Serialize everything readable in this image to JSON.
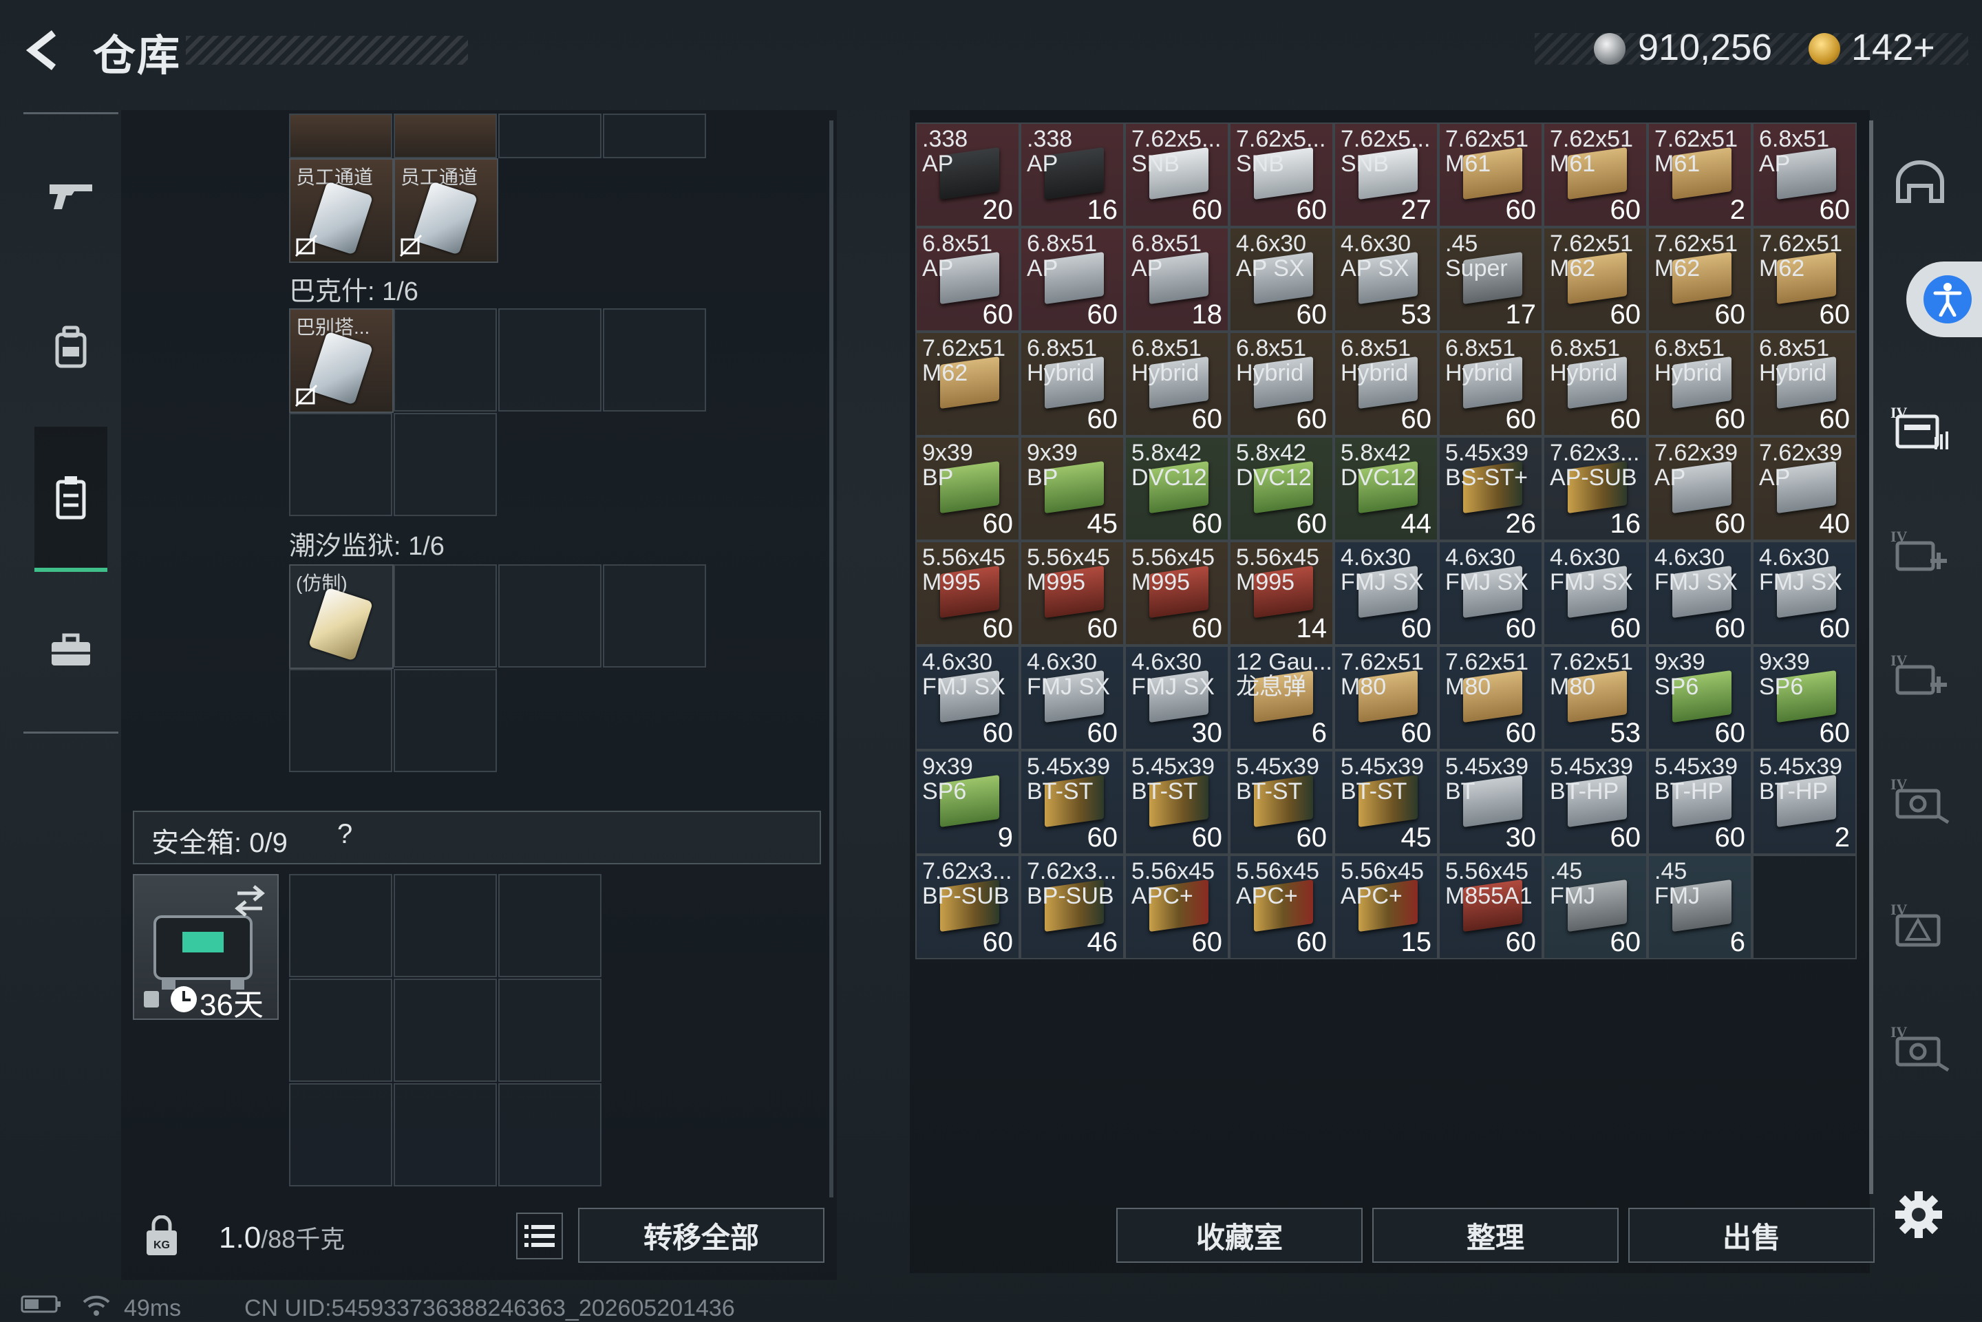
{
  "header": {
    "title": "仓库",
    "currency1": "910,256",
    "currency2": "142+"
  },
  "left_rail": {
    "icons": [
      "gun-icon",
      "backpack-icon",
      "storage-icon",
      "briefcase-icon"
    ]
  },
  "stash": {
    "item_label_1": "员工通道",
    "item_label_2": "员工通道",
    "section1_label": "巴克什: 1/6",
    "item_label_3": "巴别塔...",
    "section2_label": "潮汐监狱: 1/6",
    "item_label_4": "(仿制)",
    "safebox_label": "安全箱:  0/9",
    "safebox_help": "?",
    "safebox_days": "36天",
    "weight_value": "1.0",
    "weight_max": "/88千克",
    "transfer_label": "转移全部"
  },
  "ammo": [
    {
      "n1": ".338",
      "n2": "AP",
      "count": "20",
      "kind": "dark-box",
      "bg": "#4a2b30"
    },
    {
      "n1": ".338",
      "n2": "AP",
      "count": "16",
      "kind": "dark-box",
      "bg": "#4a2b30"
    },
    {
      "n1": "7.62x5...",
      "n2": "SNB",
      "count": "60",
      "kind": "white-box",
      "bg": "#4a2b30"
    },
    {
      "n1": "7.62x5...",
      "n2": "SNB",
      "count": "60",
      "kind": "white-box",
      "bg": "#4a2b30"
    },
    {
      "n1": "7.62x5...",
      "n2": "SNB",
      "count": "27",
      "kind": "white-box",
      "bg": "#4a2b30"
    },
    {
      "n1": "7.62x51",
      "n2": "M61",
      "count": "60",
      "kind": "tan-box",
      "bg": "#4a2b30"
    },
    {
      "n1": "7.62x51",
      "n2": "M61",
      "count": "60",
      "kind": "tan-box",
      "bg": "#4a2b30"
    },
    {
      "n1": "7.62x51",
      "n2": "M61",
      "count": "2",
      "kind": "tan-box",
      "bg": "#4a2b30"
    },
    {
      "n1": "6.8x51",
      "n2": "AP",
      "count": "60",
      "kind": "silver-box",
      "bg": "#4a2b30"
    },
    {
      "n1": "6.8x51",
      "n2": "AP",
      "count": "60",
      "kind": "silver-box",
      "bg": "#4a2b30"
    },
    {
      "n1": "6.8x51",
      "n2": "AP",
      "count": "60",
      "kind": "silver-box",
      "bg": "#4a2b30"
    },
    {
      "n1": "6.8x51",
      "n2": "AP",
      "count": "18",
      "kind": "silver-box",
      "bg": "#4a2b30"
    },
    {
      "n1": "4.6x30",
      "n2": "AP SX",
      "count": "60",
      "kind": "silver-box",
      "bg": "#3e3428"
    },
    {
      "n1": "4.6x30",
      "n2": "AP SX",
      "count": "53",
      "kind": "silver-box",
      "bg": "#3e3428"
    },
    {
      "n1": ".45",
      "n2": "Super",
      "count": "17",
      "kind": "grey-box",
      "bg": "#3e3428"
    },
    {
      "n1": "7.62x51",
      "n2": "M62",
      "count": "60",
      "kind": "tan-box",
      "bg": "#3e3428"
    },
    {
      "n1": "7.62x51",
      "n2": "M62",
      "count": "60",
      "kind": "tan-box",
      "bg": "#3e3428"
    },
    {
      "n1": "7.62x51",
      "n2": "M62",
      "count": "60",
      "kind": "tan-box",
      "bg": "#3e3428"
    },
    {
      "n1": "7.62x51",
      "n2": "M62",
      "count": "",
      "kind": "tan-box",
      "bg": "#3e3428"
    },
    {
      "n1": "6.8x51",
      "n2": "Hybrid",
      "count": "60",
      "kind": "silver-box",
      "bg": "#3e3428"
    },
    {
      "n1": "6.8x51",
      "n2": "Hybrid",
      "count": "60",
      "kind": "silver-box",
      "bg": "#3e3428"
    },
    {
      "n1": "6.8x51",
      "n2": "Hybrid",
      "count": "60",
      "kind": "silver-box",
      "bg": "#3e3428"
    },
    {
      "n1": "6.8x51",
      "n2": "Hybrid",
      "count": "60",
      "kind": "silver-box",
      "bg": "#3e3428"
    },
    {
      "n1": "6.8x51",
      "n2": "Hybrid",
      "count": "60",
      "kind": "silver-box",
      "bg": "#3e3428"
    },
    {
      "n1": "6.8x51",
      "n2": "Hybrid",
      "count": "60",
      "kind": "silver-box",
      "bg": "#3e3428"
    },
    {
      "n1": "6.8x51",
      "n2": "Hybrid",
      "count": "60",
      "kind": "silver-box",
      "bg": "#3e3428"
    },
    {
      "n1": "6.8x51",
      "n2": "Hybrid",
      "count": "60",
      "kind": "silver-box",
      "bg": "#3e3428"
    },
    {
      "n1": "9x39",
      "n2": "BP",
      "count": "60",
      "kind": "green-box",
      "bg": "#3e3428"
    },
    {
      "n1": "9x39",
      "n2": "BP",
      "count": "45",
      "kind": "green-box",
      "bg": "#3e3428"
    },
    {
      "n1": "5.8x42",
      "n2": "DVC12",
      "count": "60",
      "kind": "green-box",
      "bg": "#2f3b2c"
    },
    {
      "n1": "5.8x42",
      "n2": "DVC12",
      "count": "60",
      "kind": "green-box",
      "bg": "#2f3b2c"
    },
    {
      "n1": "5.8x42",
      "n2": "DVC12",
      "count": "44",
      "kind": "green-box",
      "bg": "#2f3b2c"
    },
    {
      "n1": "5.45x39",
      "n2": "BS-ST+",
      "count": "26",
      "kind": "bullets",
      "bg": "#2a3037"
    },
    {
      "n1": "7.62x3...",
      "n2": "AP-SUB",
      "count": "16",
      "kind": "bullets",
      "bg": "#2a3037"
    },
    {
      "n1": "7.62x39",
      "n2": "AP",
      "count": "60",
      "kind": "silver-box",
      "bg": "#3e3428"
    },
    {
      "n1": "7.62x39",
      "n2": "AP",
      "count": "40",
      "kind": "silver-box",
      "bg": "#3e3428"
    },
    {
      "n1": "5.56x45",
      "n2": "M995",
      "count": "60",
      "kind": "red-box",
      "bg": "#3e3428"
    },
    {
      "n1": "5.56x45",
      "n2": "M995",
      "count": "60",
      "kind": "red-box",
      "bg": "#3e3428"
    },
    {
      "n1": "5.56x45",
      "n2": "M995",
      "count": "60",
      "kind": "red-box",
      "bg": "#3e3428"
    },
    {
      "n1": "5.56x45",
      "n2": "M995",
      "count": "14",
      "kind": "red-box",
      "bg": "#3e3428"
    },
    {
      "n1": "4.6x30",
      "n2": "FMJ SX",
      "count": "60",
      "kind": "silver-box",
      "bg": "#232f3c"
    },
    {
      "n1": "4.6x30",
      "n2": "FMJ SX",
      "count": "60",
      "kind": "silver-box",
      "bg": "#232f3c"
    },
    {
      "n1": "4.6x30",
      "n2": "FMJ SX",
      "count": "60",
      "kind": "silver-box",
      "bg": "#232f3c"
    },
    {
      "n1": "4.6x30",
      "n2": "FMJ SX",
      "count": "60",
      "kind": "silver-box",
      "bg": "#232f3c"
    },
    {
      "n1": "4.6x30",
      "n2": "FMJ SX",
      "count": "60",
      "kind": "silver-box",
      "bg": "#232f3c"
    },
    {
      "n1": "4.6x30",
      "n2": "FMJ SX",
      "count": "60",
      "kind": "silver-box",
      "bg": "#232f3c"
    },
    {
      "n1": "4.6x30",
      "n2": "FMJ SX",
      "count": "60",
      "kind": "silver-box",
      "bg": "#232f3c"
    },
    {
      "n1": "4.6x30",
      "n2": "FMJ SX",
      "count": "30",
      "kind": "silver-box",
      "bg": "#232f3c"
    },
    {
      "n1": "12 Gau...",
      "n2": "龙息弹",
      "count": "6",
      "kind": "tan-box",
      "bg": "#232f3c"
    },
    {
      "n1": "7.62x51",
      "n2": "M80",
      "count": "60",
      "kind": "tan-box",
      "bg": "#232f3c"
    },
    {
      "n1": "7.62x51",
      "n2": "M80",
      "count": "60",
      "kind": "tan-box",
      "bg": "#232f3c"
    },
    {
      "n1": "7.62x51",
      "n2": "M80",
      "count": "53",
      "kind": "tan-box",
      "bg": "#232f3c"
    },
    {
      "n1": "9x39",
      "n2": "SP6",
      "count": "60",
      "kind": "green-box",
      "bg": "#232f3c"
    },
    {
      "n1": "9x39",
      "n2": "SP6",
      "count": "60",
      "kind": "green-box",
      "bg": "#232f3c"
    },
    {
      "n1": "9x39",
      "n2": "SP6",
      "count": "9",
      "kind": "green-box",
      "bg": "#232f3c"
    },
    {
      "n1": "5.45x39",
      "n2": "BT-ST",
      "count": "60",
      "kind": "bullets",
      "bg": "#232f3c"
    },
    {
      "n1": "5.45x39",
      "n2": "BT-ST",
      "count": "60",
      "kind": "bullets",
      "bg": "#232f3c"
    },
    {
      "n1": "5.45x39",
      "n2": "BT-ST",
      "count": "60",
      "kind": "bullets",
      "bg": "#232f3c"
    },
    {
      "n1": "5.45x39",
      "n2": "BT-ST",
      "count": "45",
      "kind": "bullets",
      "bg": "#232f3c"
    },
    {
      "n1": "5.45x39",
      "n2": "BT",
      "count": "30",
      "kind": "silver-box",
      "bg": "#232f3c"
    },
    {
      "n1": "5.45x39",
      "n2": "BT-HP",
      "count": "60",
      "kind": "silver-box",
      "bg": "#232f3c"
    },
    {
      "n1": "5.45x39",
      "n2": "BT-HP",
      "count": "60",
      "kind": "silver-box",
      "bg": "#232f3c"
    },
    {
      "n1": "5.45x39",
      "n2": "BT-HP",
      "count": "2",
      "kind": "silver-box",
      "bg": "#232f3c"
    },
    {
      "n1": "7.62x3...",
      "n2": "BP-SUB",
      "count": "60",
      "kind": "bullets",
      "bg": "#232f3c"
    },
    {
      "n1": "7.62x3...",
      "n2": "BP-SUB",
      "count": "46",
      "kind": "bullets",
      "bg": "#232f3c"
    },
    {
      "n1": "5.56x45",
      "n2": "APC+",
      "count": "60",
      "kind": "bullets-red",
      "bg": "#232f3c"
    },
    {
      "n1": "5.56x45",
      "n2": "APC+",
      "count": "60",
      "kind": "bullets-red",
      "bg": "#232f3c"
    },
    {
      "n1": "5.56x45",
      "n2": "APC+",
      "count": "15",
      "kind": "bullets-red",
      "bg": "#232f3c"
    },
    {
      "n1": "5.56x45",
      "n2": "M855A1",
      "count": "60",
      "kind": "red-box",
      "bg": "#232f3c"
    },
    {
      "n1": ".45",
      "n2": "FMJ",
      "count": "60",
      "kind": "grey-box",
      "bg": "#2a3a44"
    },
    {
      "n1": ".45",
      "n2": "FMJ",
      "count": "6",
      "kind": "grey-box",
      "bg": "#2a3a44"
    }
  ],
  "right_rail": {
    "icons": [
      "helmet-icon",
      "accessibility-icon",
      "card-folder-icon",
      "add-slot-icon",
      "add-slot-icon",
      "camera-slot-icon",
      "warning-slot-icon",
      "camera-slot-icon"
    ]
  },
  "bottom_buttons": {
    "collection": "收藏室",
    "organize": "整理",
    "sell": "出售"
  },
  "status": {
    "ping": "49ms",
    "uid": "CN UID:5459337363882463​63_202605201436"
  },
  "colors": {
    "accent": "#3fbf8a",
    "accessibility": "#2d7ff0"
  }
}
